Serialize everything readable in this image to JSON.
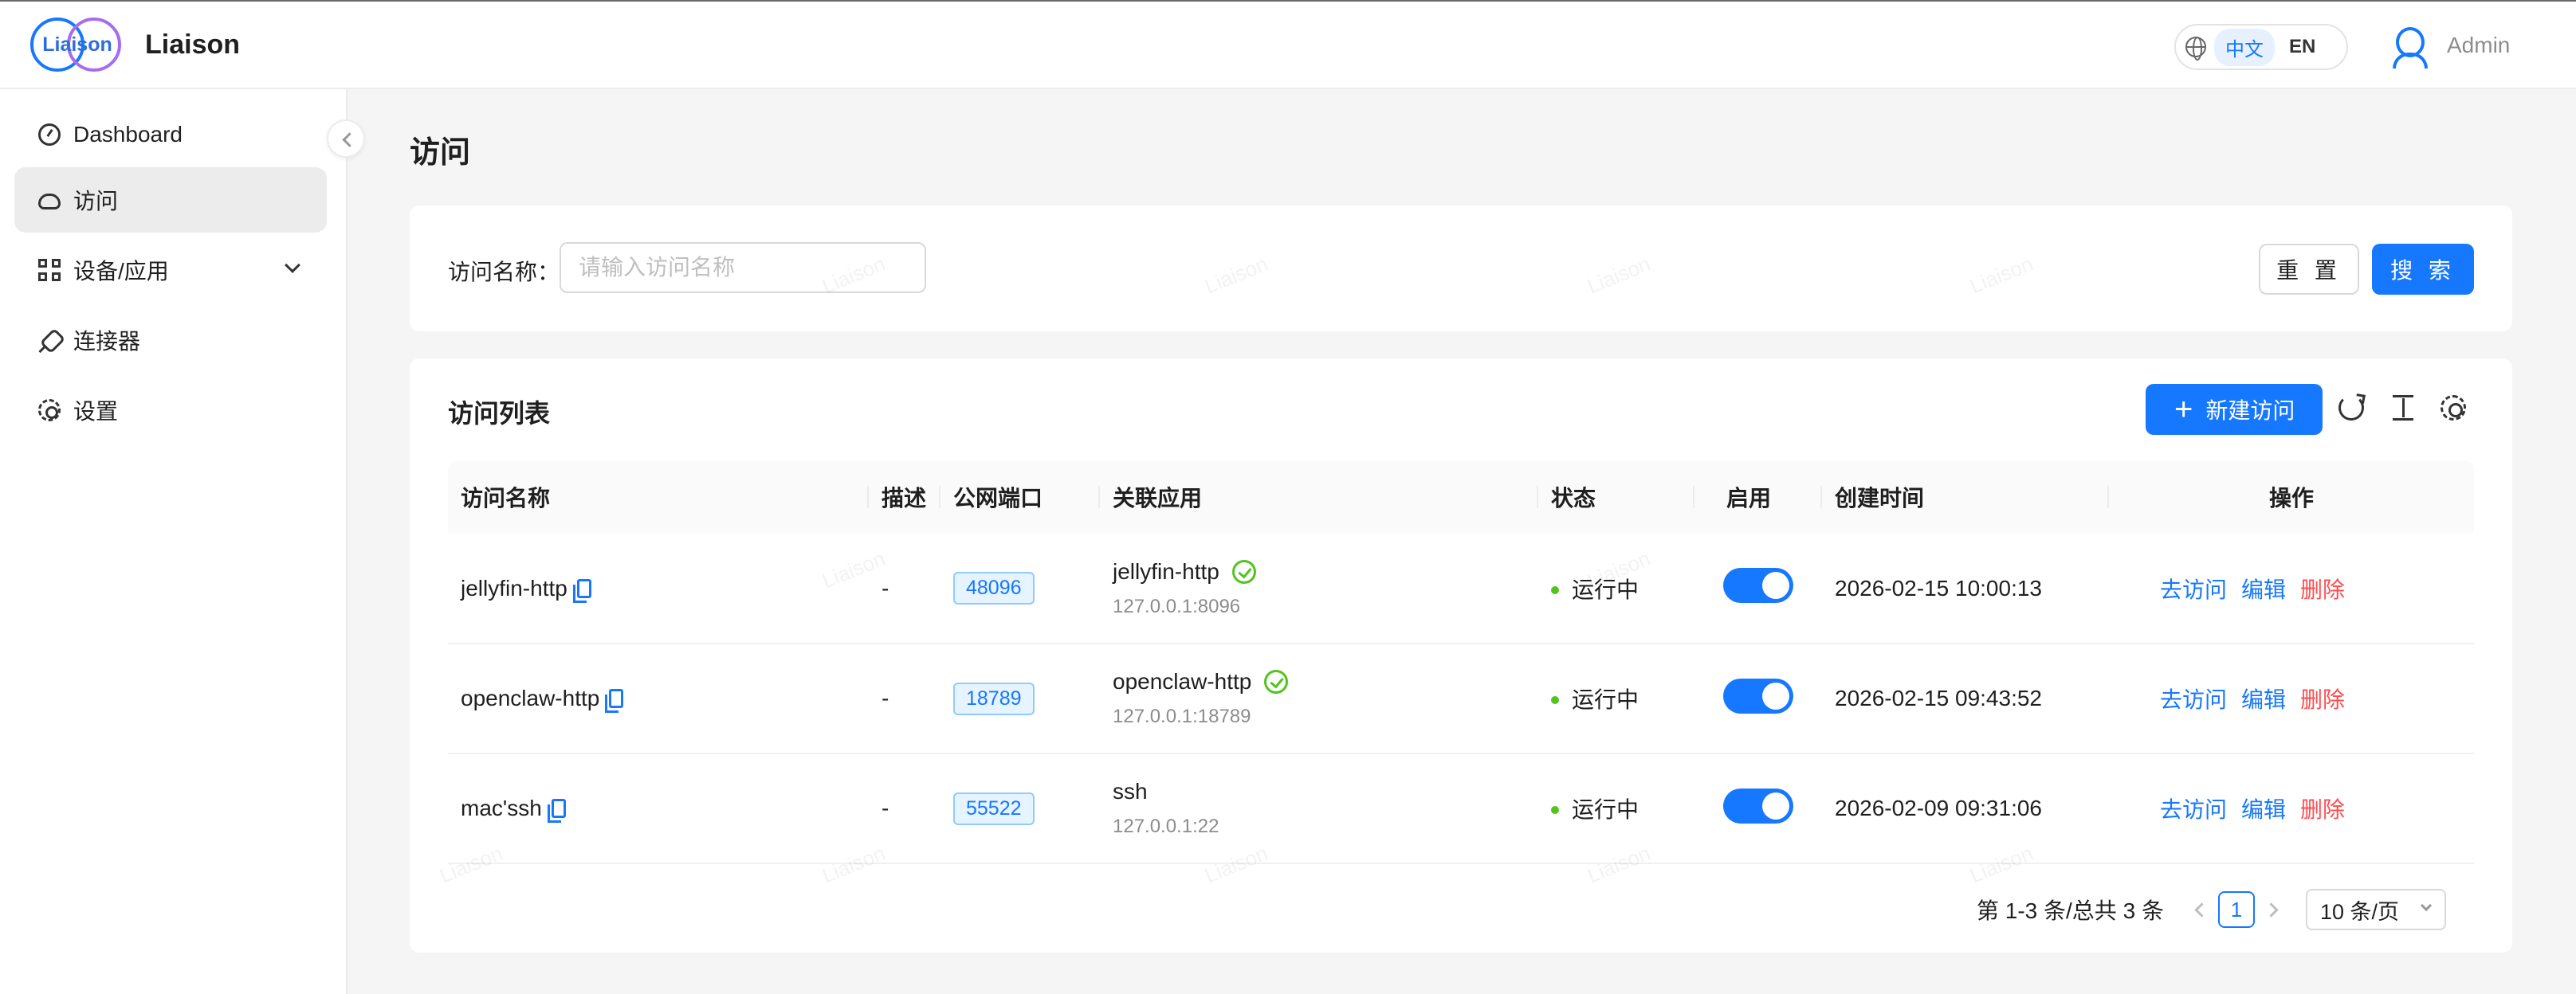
{
  "header": {
    "logo_text": "Liaison",
    "brand": "Liaison",
    "lang_zh": "中文",
    "lang_en": "EN",
    "user": "Admin"
  },
  "sidebar": {
    "items": [
      {
        "label": "Dashboard",
        "icon": "dashboard-icon"
      },
      {
        "label": "访问",
        "icon": "cloud-icon",
        "active": true
      },
      {
        "label": "设备/应用",
        "icon": "apps-grid-icon",
        "expandable": true
      },
      {
        "label": "连接器",
        "icon": "plug-icon"
      },
      {
        "label": "设置",
        "icon": "gear-icon"
      }
    ]
  },
  "page": {
    "title": "访问"
  },
  "search": {
    "label": "访问名称：",
    "placeholder": "请输入访问名称",
    "reset_label": "重 置",
    "search_label": "搜 索"
  },
  "list": {
    "title": "访问列表",
    "new_label": "新建访问",
    "columns": [
      "访问名称",
      "描述",
      "公网端口",
      "关联应用",
      "状态",
      "启用",
      "创建时间",
      "操作"
    ],
    "rows": [
      {
        "name": "jellyfin-http",
        "desc": "-",
        "port": "48096",
        "app": "jellyfin-http",
        "app_ok": true,
        "addr": "127.0.0.1:8096",
        "status": "运行中",
        "enabled": true,
        "created": "2026-02-15 10:00:13"
      },
      {
        "name": "openclaw-http",
        "desc": "-",
        "port": "18789",
        "app": "openclaw-http",
        "app_ok": true,
        "addr": "127.0.0.1:18789",
        "status": "运行中",
        "enabled": true,
        "created": "2026-02-15 09:43:52"
      },
      {
        "name": "mac'ssh",
        "desc": "-",
        "port": "55522",
        "app": "ssh",
        "app_ok": false,
        "addr": "127.0.0.1:22",
        "status": "运行中",
        "enabled": true,
        "created": "2026-02-09 09:31:06"
      }
    ],
    "actions": {
      "visit": "去访问",
      "edit": "编辑",
      "delete": "删除"
    },
    "pagination": {
      "summary": "第 1-3 条/总共 3 条",
      "current_page": "1",
      "page_size": "10 条/页"
    }
  },
  "colors": {
    "primary": "#1677ff",
    "danger": "#ff4d4f",
    "success": "#52c41a"
  },
  "watermark": "Liaison"
}
